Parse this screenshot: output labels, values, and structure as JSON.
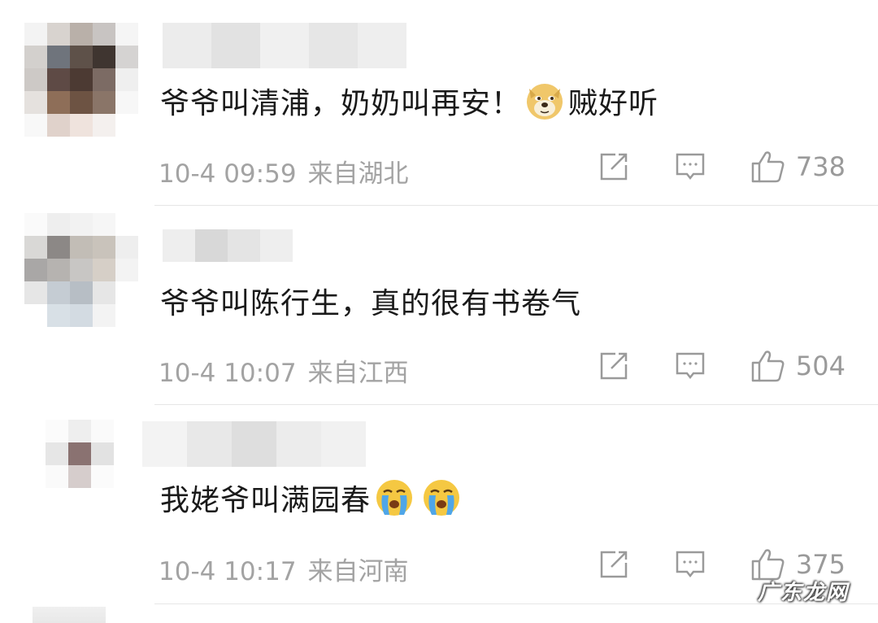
{
  "comments": [
    {
      "text_before": "爷爷叫清浦，奶奶叫再安！",
      "emoji": "doge-emoji",
      "text_after": "贼好听",
      "date": "10-4 09:59",
      "location": "来自湖北",
      "likes": "738"
    },
    {
      "text_before": "爷爷叫陈行生，真的很有书卷气",
      "text_after": "",
      "date": "10-4 10:07",
      "location": "来自江西",
      "likes": "504"
    },
    {
      "text_before": "我姥爷叫满园春",
      "emoji": "crying-emoji",
      "text_after": "",
      "date": "10-4 10:17",
      "location": "来自河南",
      "likes": "375"
    }
  ],
  "icons": {
    "share": "share-icon",
    "reply": "comment-icon",
    "like": "thumbs-up-icon"
  },
  "colors": {
    "text": "#1a1a1a",
    "meta": "#a3a3a3",
    "icon": "#9a9a9a",
    "divider": "#e6e6e6"
  },
  "watermark": "广东龙网"
}
